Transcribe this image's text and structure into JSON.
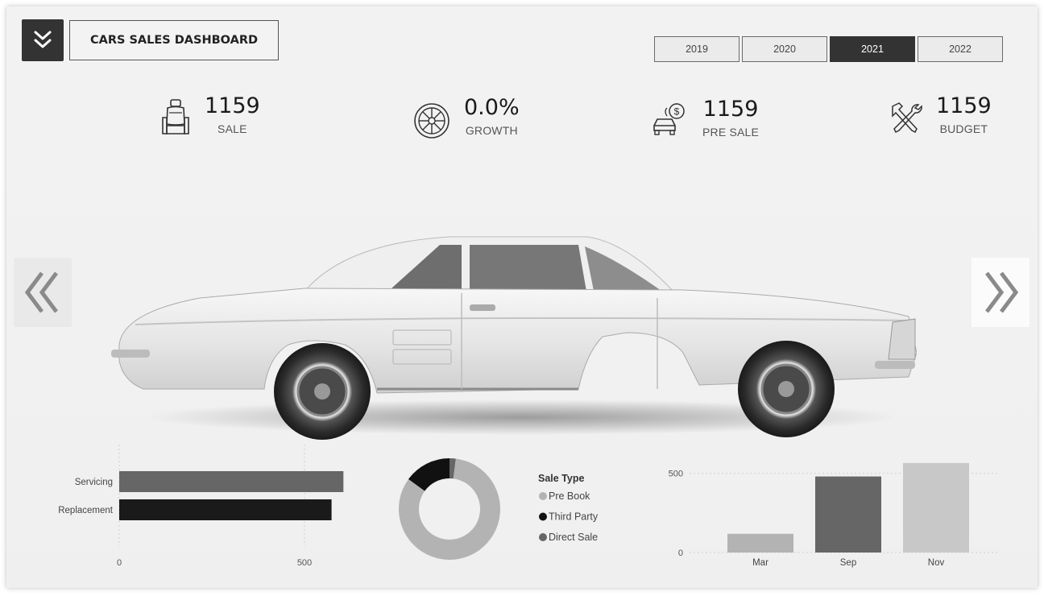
{
  "header": {
    "menu_icon": "double-chevron-down-icon",
    "title": "CARS SALES DASHBOARD"
  },
  "year_tabs": {
    "items": [
      "2019",
      "2020",
      "2021",
      "2022"
    ],
    "active": "2021"
  },
  "kpis": [
    {
      "value": "1159",
      "label": "SALE",
      "icon": "car-seat-icon"
    },
    {
      "value": "0.0%",
      "label": "GROWTH",
      "icon": "tire-icon"
    },
    {
      "value": "1159",
      "label": "PRE SALE",
      "icon": "car-dollar-icon"
    },
    {
      "value": "1159",
      "label": "BUDGET",
      "icon": "tools-icon"
    }
  ],
  "nav": {
    "prev_icon": "double-chevron-left-icon",
    "next_icon": "double-chevron-right-icon"
  },
  "hero_image": "classic-car-side-view",
  "chart_data": [
    {
      "type": "bar",
      "orientation": "horizontal",
      "categories": [
        "Servicing",
        "Replacement"
      ],
      "values": [
        605,
        573
      ],
      "colors": [
        "#666666",
        "#1a1a1a"
      ],
      "xlim": [
        0,
        600
      ],
      "xticks": [
        0,
        500
      ],
      "grid": true
    },
    {
      "type": "pie",
      "style": "donut",
      "legend_title": "Sale Type",
      "labels": [
        "Pre Book",
        "Third Party",
        "Direct Sale"
      ],
      "values": [
        83,
        15,
        2
      ],
      "colors": [
        "#b3b3b3",
        "#111111",
        "#666666"
      ],
      "legend_position": "right"
    },
    {
      "type": "bar",
      "orientation": "vertical",
      "categories": [
        "Mar",
        "Sep",
        "Nov"
      ],
      "values": [
        118,
        480,
        565
      ],
      "colors": [
        "#b3b3b3",
        "#666666",
        "#c8c8c8"
      ],
      "ylim": [
        0,
        600
      ],
      "yticks": [
        0,
        500
      ],
      "grid": true
    }
  ]
}
